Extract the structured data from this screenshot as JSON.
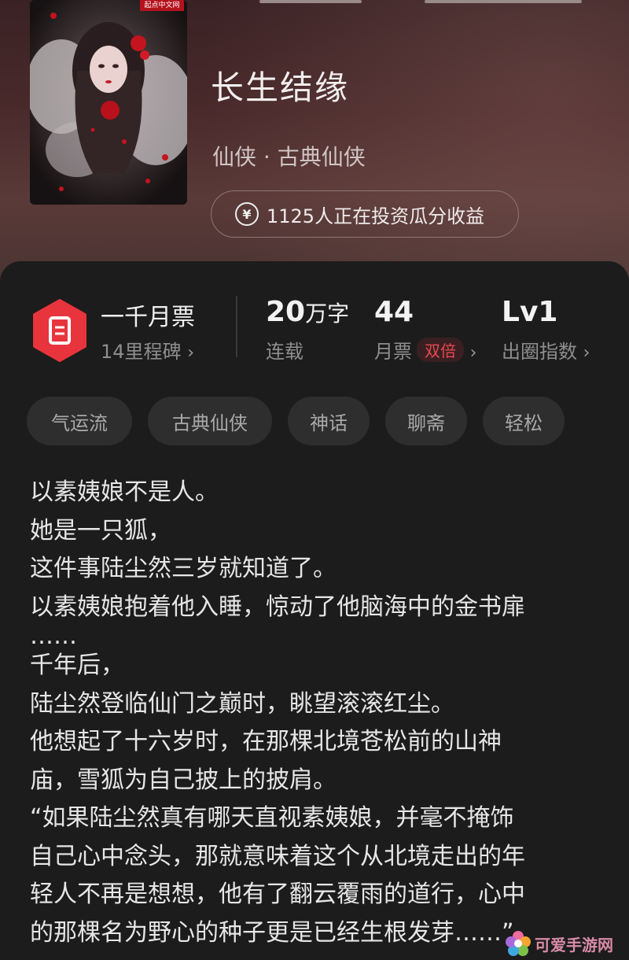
{
  "book": {
    "title": "长生结缘",
    "genre": "仙侠 · 古典仙侠",
    "cover_publisher": "起点中文网",
    "invest_text": "1125人正在投资瓜分收益",
    "invest_icon": "yen-icon"
  },
  "stats": {
    "milestone_title": "一千月票",
    "milestone_sub": "14里程碑",
    "words_num": "20",
    "words_unit": "万字",
    "words_label": "连载",
    "votes_num": "44",
    "votes_label": "月票",
    "votes_badge": "双倍",
    "level_num": "Lv1",
    "level_label": "出圈指数",
    "chevron": "›"
  },
  "tags": [
    "气运流",
    "古典仙侠",
    "神话",
    "聊斋",
    "轻松"
  ],
  "description": [
    "以素姨娘不是人。",
    "她是一只狐，",
    "这件事陆尘然三岁就知道了。",
    "以素姨娘抱着他入睡，惊动了他脑海中的金书扉",
    "……",
    "千年后，",
    "陆尘然登临仙门之巅时，眺望滚滚红尘。",
    "他想起了十六岁时，在那棵北境苍松前的山神",
    "庙，雪狐为自己披上的披肩。",
    "“如果陆尘然真有哪天直视素姨娘，并毫不掩饰",
    "自己心中念头，那就意味着这个从北境走出的年",
    "轻人不再是想想，他有了翻云覆雨的道行，心中",
    "的那棵名为野心的种子更是已经生根发芽……”"
  ],
  "watermark": {
    "text": "可爱手游网"
  },
  "colors": {
    "accent_red": "#e8343c",
    "badge_text": "#e64a50",
    "panel_bg": "#1c1c1c"
  }
}
